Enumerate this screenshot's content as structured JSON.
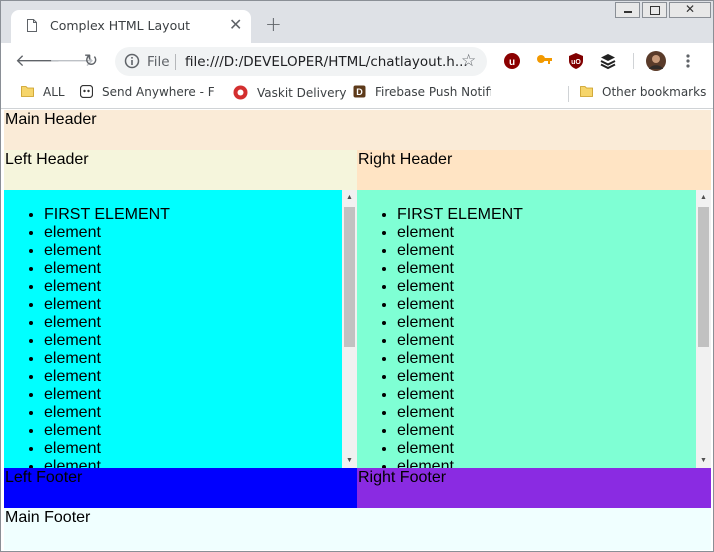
{
  "browser": {
    "tab_title": "Complex HTML Layout",
    "omnibox_scheme": "File",
    "omnibox_url": "file:///D:/DEVELOPER/HTML/chatlayout.h...",
    "bookmarks": [
      "ALL",
      "Send Anywhere - File",
      "Vaskit Delivery",
      "Firebase Push Notific",
      "Other bookmarks"
    ]
  },
  "page": {
    "main_header": "Main Header",
    "left_header": "Left Header",
    "right_header": "Right Header",
    "left_list": [
      "FIRST ELEMENT",
      "element",
      "element",
      "element",
      "element",
      "element",
      "element",
      "element",
      "element",
      "element",
      "element",
      "element",
      "element",
      "element",
      "element"
    ],
    "right_list": [
      "FIRST ELEMENT",
      "element",
      "element",
      "element",
      "element",
      "element",
      "element",
      "element",
      "element",
      "element",
      "element",
      "element",
      "element",
      "element",
      "element"
    ],
    "left_footer": "Left Footer",
    "right_footer": "Right Footer",
    "main_footer": "Main Footer"
  },
  "colors": {
    "main_header": "#faebd7",
    "left_header": "#f5f5dc",
    "right_header": "#ffe4c4",
    "left_body": "#00ffff",
    "right_body": "#7fffd4",
    "left_footer": "#0000ff",
    "right_footer": "#8a2be2",
    "main_footer": "#f0ffff"
  },
  "icons": {
    "tab": "page-icon",
    "close": "close-icon",
    "new_tab": "plus-icon",
    "back": "back-arrow-icon",
    "forward": "forward-arrow-icon",
    "reload": "reload-icon",
    "info": "info-icon",
    "bookmark_star": "star-icon",
    "extensions": [
      "ublock-icon",
      "key-icon",
      "ublock-origin-icon",
      "buffer-icon"
    ],
    "profile": "avatar",
    "menu": "more-vert-icon"
  }
}
